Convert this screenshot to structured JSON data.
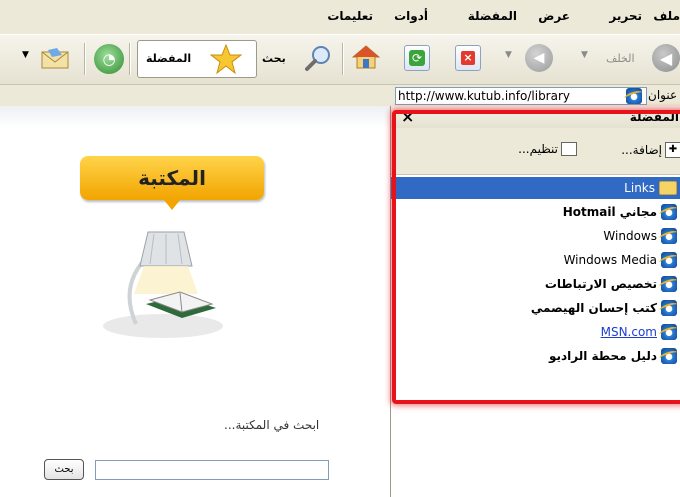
{
  "menu": {
    "file": "ملف",
    "edit": "تحرير",
    "view": "عرض",
    "favorites": "المفضلة",
    "tools": "أدوات",
    "help": "تعليمات"
  },
  "toolbar": {
    "back_label": "الخلف",
    "search_label": "بحث",
    "favorites_label": "المفضلة"
  },
  "address": {
    "label": "عنوان",
    "url": "http://www.kutub.info/library"
  },
  "page": {
    "logo_text": "المكتبة",
    "search_caption": "ابحث في المكتبة...",
    "search_button": "بحث",
    "search_value": ""
  },
  "favorites_pane": {
    "title": "المفضلة",
    "add_label": "إضافة...",
    "organize_label": "تنظيم...",
    "close_glyph": "×",
    "items": [
      {
        "label": "Links",
        "icon": "folder-icon",
        "selected": true,
        "bold": false,
        "link": false
      },
      {
        "label": "Hotmail مجاني",
        "icon": "ie-icon",
        "selected": false,
        "bold": true,
        "link": false
      },
      {
        "label": "Windows",
        "icon": "ie-icon",
        "selected": false,
        "bold": false,
        "link": false
      },
      {
        "label": "Windows Media",
        "icon": "ie-icon",
        "selected": false,
        "bold": false,
        "link": false
      },
      {
        "label": "تخصيص الارتباطات",
        "icon": "ie-icon",
        "selected": false,
        "bold": true,
        "link": false
      },
      {
        "label": "كتب إحسان الهيصمي",
        "icon": "ie-icon",
        "selected": false,
        "bold": true,
        "link": false
      },
      {
        "label": "MSN.com",
        "icon": "ie-icon",
        "selected": false,
        "bold": false,
        "link": true
      },
      {
        "label": "دليل محطة الراديو",
        "icon": "ie-icon",
        "selected": false,
        "bold": true,
        "link": false
      }
    ]
  },
  "colors": {
    "highlight": "#e8121a",
    "selection": "#316ac5",
    "chrome": "#ece9d8"
  }
}
